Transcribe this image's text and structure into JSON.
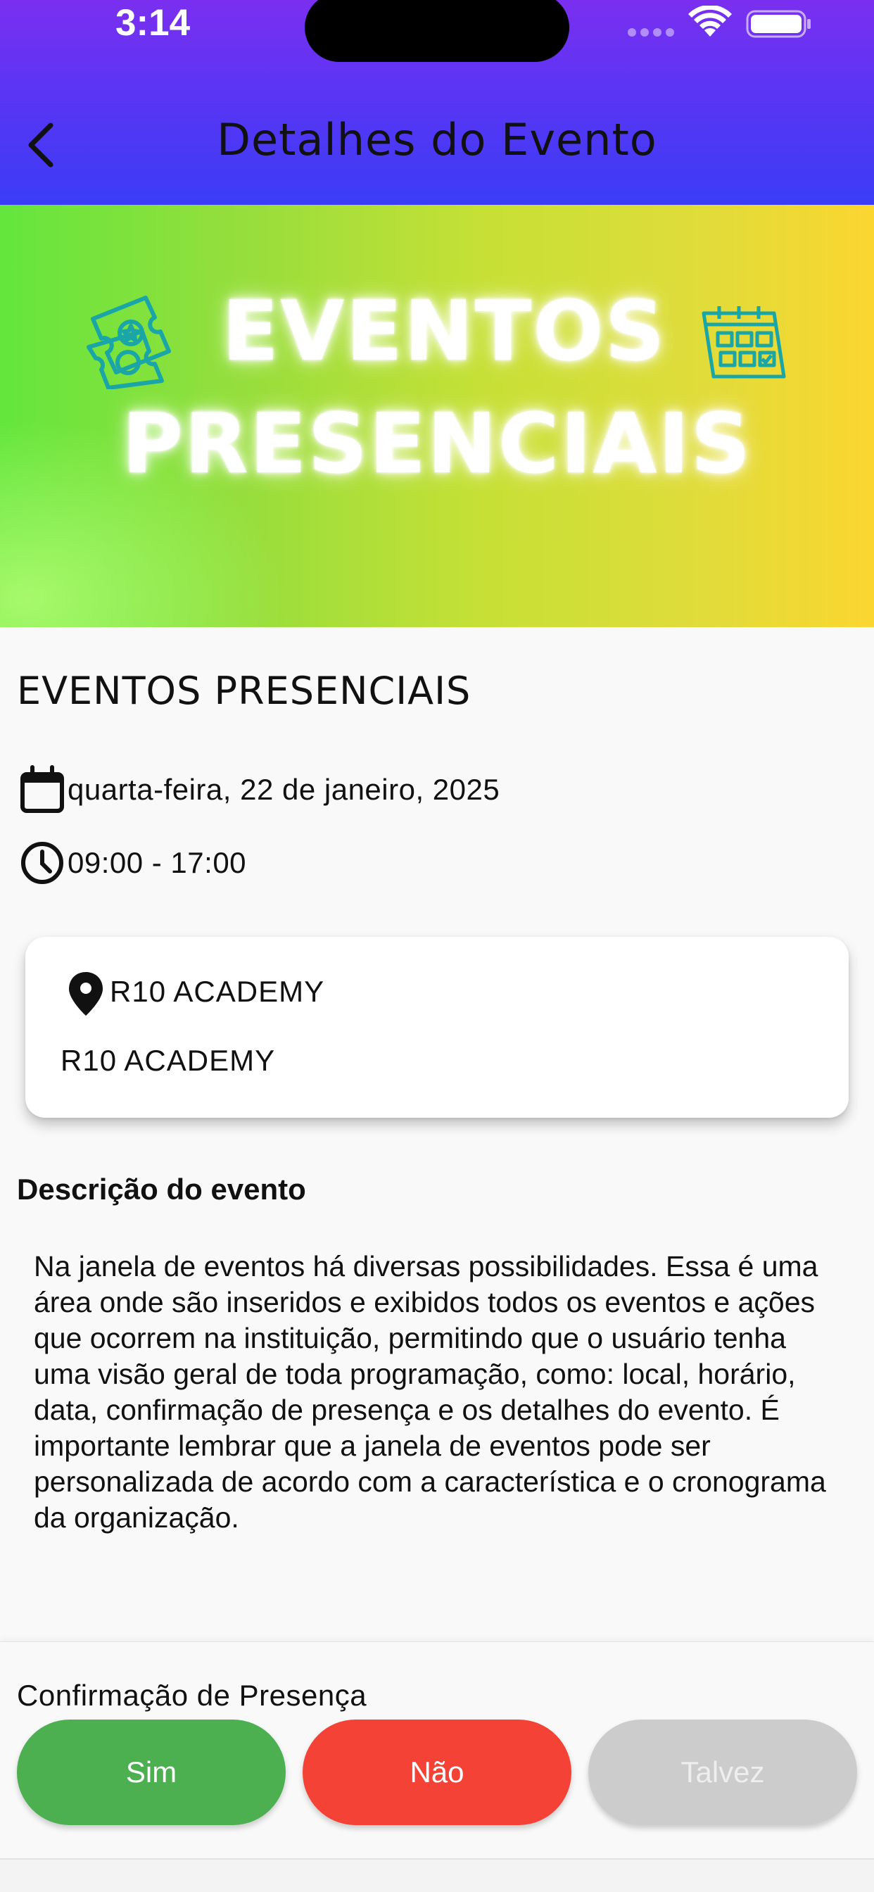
{
  "status_bar": {
    "time": "3:14"
  },
  "header": {
    "title": "Detalhes do Evento",
    "back_icon": "chevron-left-icon",
    "gradient": [
      "#7b2ff0",
      "#3b3cf6"
    ]
  },
  "banner": {
    "line1": "EVENTOS",
    "line2": "PRESENCIAIS",
    "icons": [
      "ticket-icon",
      "calendar-icon"
    ],
    "gradient": [
      "#64e63d",
      "#fbd630"
    ]
  },
  "event": {
    "name": "EVENTOS PRESENCIAIS",
    "date": "quarta-feira, 22 de janeiro, 2025",
    "time": "09:00 - 17:00",
    "location": {
      "name": "R10 ACADEMY",
      "address": "R10 ACADEMY"
    },
    "description_heading": "Descrição do evento",
    "description": "Na janela de eventos há diversas possibilidades. Essa é uma área onde são inseridos e exibidos todos os eventos e ações que ocorrem na instituição, permitindo que o usuário tenha uma visão geral de toda programação, como: local, horário, data, confirmação de presença e os detalhes do evento. É importante lembrar que a janela de eventos pode ser personalizada de acordo com a característica e o cronograma da organização."
  },
  "rsvp": {
    "label": "Confirmação de Presença",
    "yes": "Sim",
    "no": "Não",
    "maybe": "Talvez",
    "colors": {
      "yes": "#4caf50",
      "no": "#f44336",
      "maybe": "#cccccc"
    }
  }
}
